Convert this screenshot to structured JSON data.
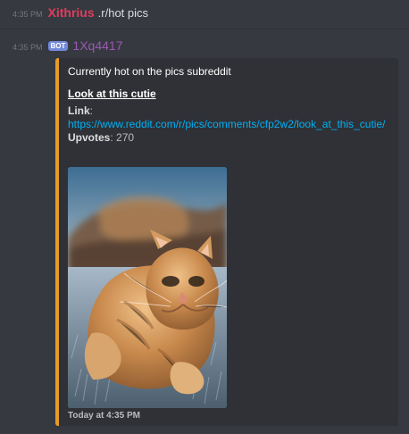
{
  "messages": [
    {
      "timestamp": "4:35 PM",
      "username": "Xithrius",
      "text": ".r/hot pics"
    },
    {
      "timestamp": "4:35 PM",
      "bot_tag": "BOT",
      "username": "1Xq4417"
    }
  ],
  "embed": {
    "description": "Currently hot on the pics subreddit",
    "title": "Look at this cutie",
    "link_label": "Link",
    "link_url": "https://www.reddit.com/r/pics/comments/cfp2w2/look_at_this_cutie/",
    "upvotes_label": "Upvotes",
    "upvotes_value": "270",
    "footer": "Today at 4:35 PM",
    "accent_color": "#e59b2a"
  },
  "colors": {
    "background": "#36393f",
    "embed_background": "#2f3136",
    "username1": "#e03c5f",
    "username2": "#9b59b6",
    "link": "#00b0f4",
    "bot_tag": "#7289da"
  }
}
